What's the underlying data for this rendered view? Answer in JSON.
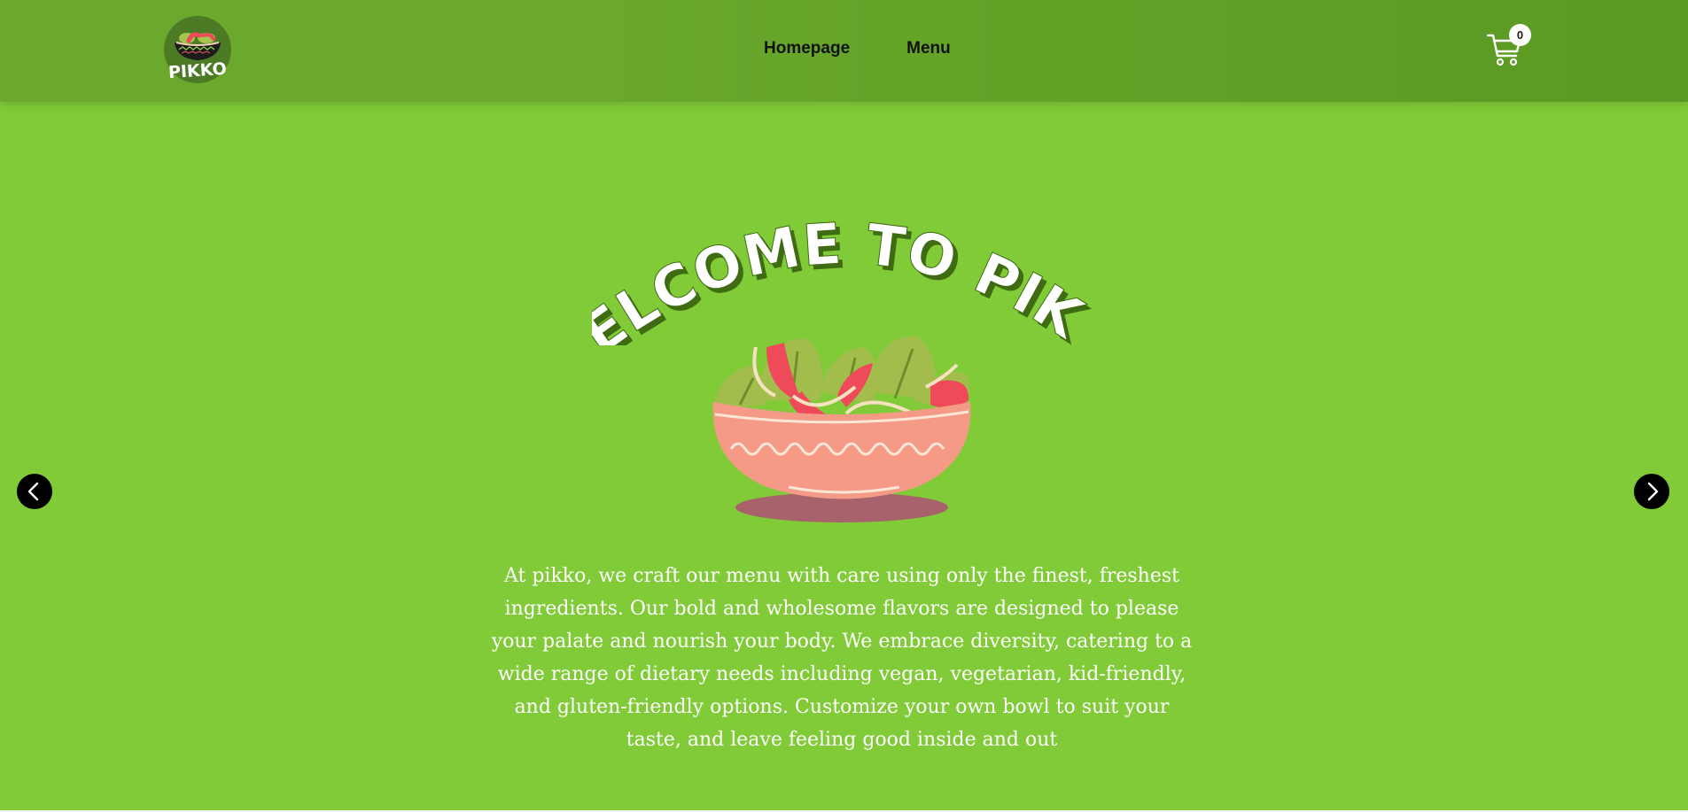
{
  "header": {
    "logo_text": "PIKKO",
    "nav": [
      {
        "label": "Homepage"
      },
      {
        "label": "Menu"
      }
    ],
    "cart": {
      "icon": "shopping-cart-icon",
      "count": "0"
    }
  },
  "hero": {
    "title": "WELCOME TO PIKKO",
    "image": "salad-bowl-illustration",
    "description": "At pikko, we craft our menu with care using only the finest, freshest ingredients. Our bold and wholesome flavors are designed to please your palate and nourish your body. We embrace diversity, catering to a wide range of dietary needs including vegan, vegetarian, kid-friendly, and gluten-friendly options. Customize your own bowl to suit your taste, and leave feeling good inside and out"
  },
  "carousel": {
    "prev_icon": "chevron-left-icon",
    "next_icon": "chevron-right-icon"
  },
  "colors": {
    "background": "#80cb37",
    "header": "#62a227",
    "text_light": "#ffffff",
    "nav_text": "#111111",
    "title_shadow": "#3f6b12",
    "bowl": "#f59a86",
    "tomato": "#ee4a5a",
    "lettuce": "#a8c24e"
  }
}
